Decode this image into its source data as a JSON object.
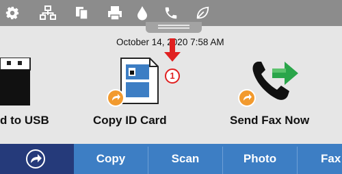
{
  "topbar": {
    "icons": [
      "gear-icon",
      "network-icon",
      "copy-pages-icon",
      "printer-icon",
      "ink-drop-icon",
      "phone-icon",
      "leaf-icon"
    ],
    "active": "phone-icon"
  },
  "status": {
    "datetime": "October 14, 2020 7:58 AM"
  },
  "annotation": {
    "number": "1",
    "color": "#e02020"
  },
  "tiles": [
    {
      "label": "d to USB",
      "icon": "usb-drive-icon"
    },
    {
      "label": "Copy ID Card",
      "icon": "id-card-icon"
    },
    {
      "label": "Send Fax Now",
      "icon": "fax-phone-icon"
    }
  ],
  "nav": {
    "items": [
      {
        "label": "Copy"
      },
      {
        "label": "Scan"
      },
      {
        "label": "Photo"
      },
      {
        "label": "Fax"
      }
    ]
  },
  "colors": {
    "topbar": "#8c8c8c",
    "nav": "#3d7ec4",
    "home": "#253a7a",
    "badge": "#f29a2e"
  }
}
